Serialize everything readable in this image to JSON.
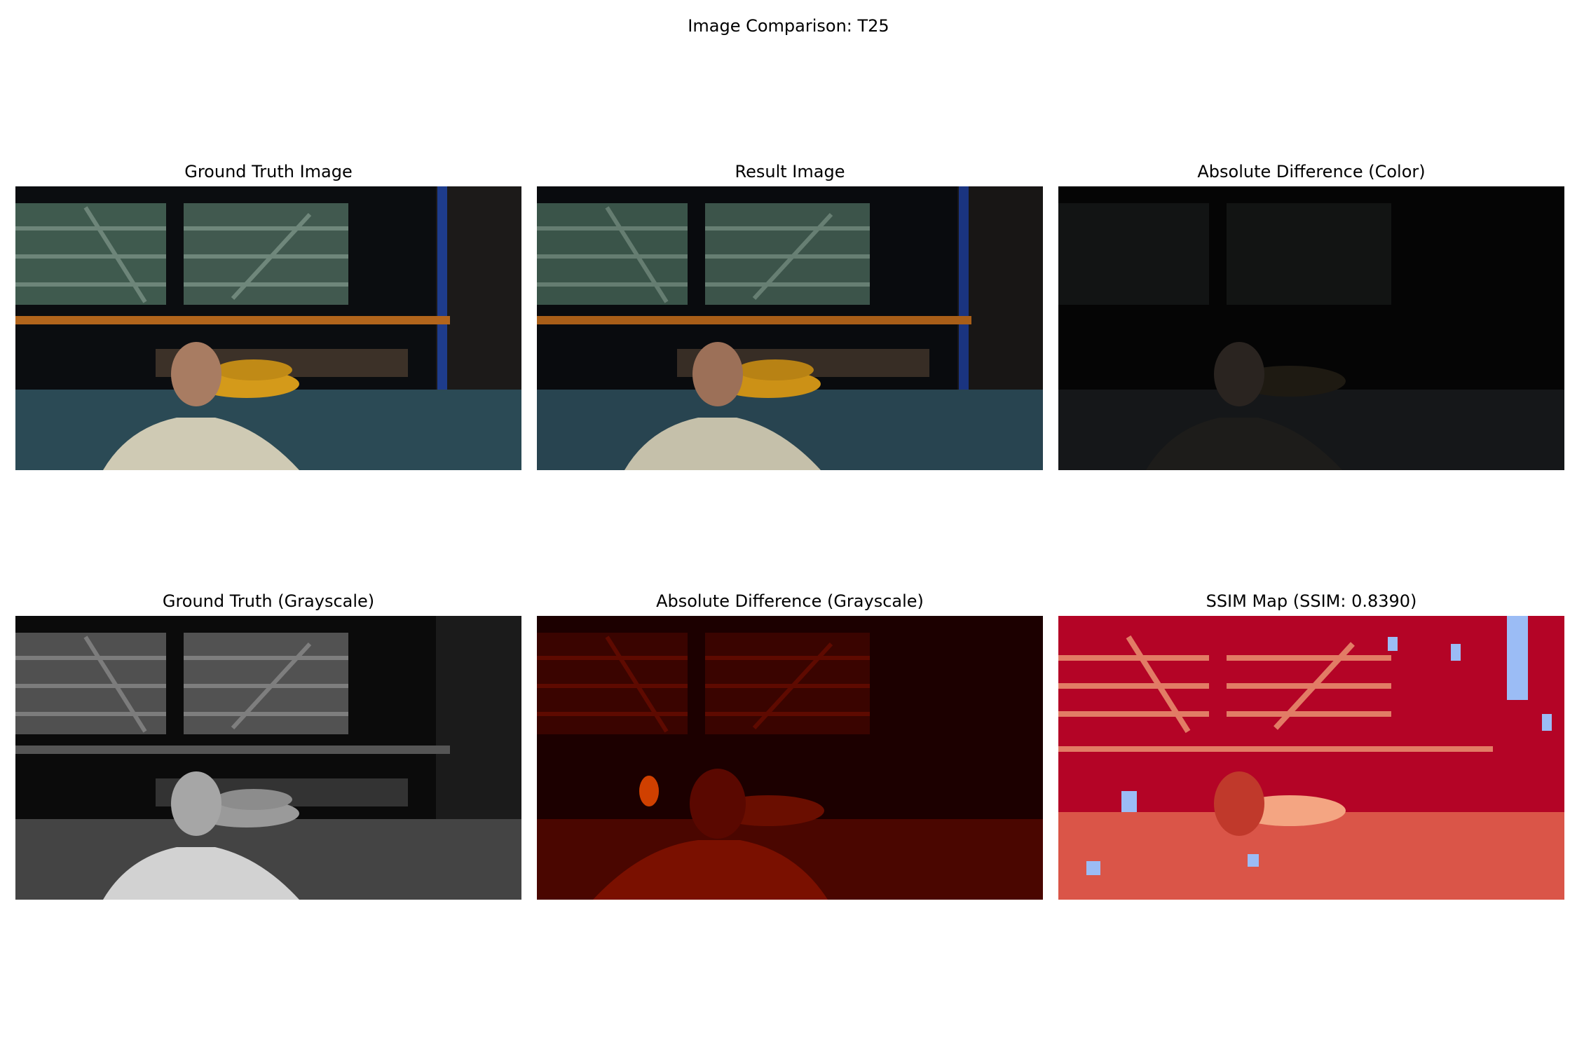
{
  "figure": {
    "title": "Image Comparison: T25"
  },
  "panels": [
    {
      "title": "Ground Truth Image",
      "kind": "color-render"
    },
    {
      "title": "Result Image",
      "kind": "color-render-darker"
    },
    {
      "title": "Absolute Difference (Color)",
      "kind": "color-difference"
    },
    {
      "title": "Ground Truth (Grayscale)",
      "kind": "grayscale-render"
    },
    {
      "title": "Absolute Difference (Grayscale)",
      "kind": "grayscale-difference-heatmap"
    },
    {
      "title": "SSIM Map (SSIM: 0.8390)",
      "kind": "ssim-heatmap"
    }
  ],
  "colors": {
    "crate": "#3f5a4e",
    "shelf": "#b2651c",
    "hose": "#d49a1a",
    "tarp": "#2b4a55",
    "shirt": "#cfcab4",
    "skin": "#a87c62",
    "heat_dark": "#1c0000",
    "heat_red": "#b01800",
    "ssim_red": "#b40426",
    "ssim_blue": "#9bbcf5"
  }
}
